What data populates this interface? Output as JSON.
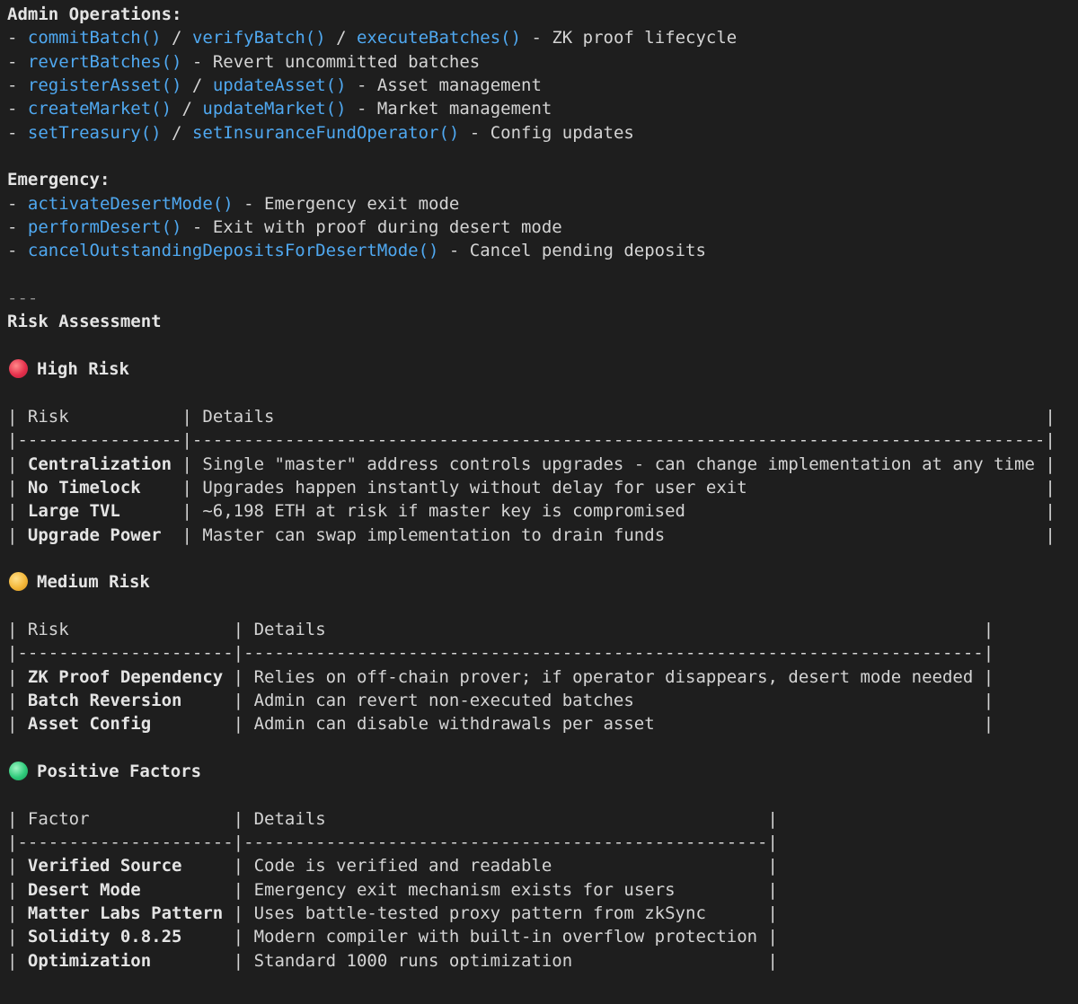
{
  "admin": {
    "heading": "Admin Operations:",
    "items": [
      {
        "fns": [
          "commitBatch()",
          "verifyBatch()",
          "executeBatches()"
        ],
        "desc": "ZK proof lifecycle"
      },
      {
        "fns": [
          "revertBatches()"
        ],
        "desc": "Revert uncommitted batches"
      },
      {
        "fns": [
          "registerAsset()",
          "updateAsset()"
        ],
        "desc": "Asset management"
      },
      {
        "fns": [
          "createMarket()",
          "updateMarket()"
        ],
        "desc": "Market management"
      },
      {
        "fns": [
          "setTreasury()",
          "setInsuranceFundOperator()"
        ],
        "desc": "Config updates"
      }
    ]
  },
  "emergency": {
    "heading": "Emergency:",
    "items": [
      {
        "fns": [
          "activateDesertMode()"
        ],
        "desc": "Emergency exit mode"
      },
      {
        "fns": [
          "performDesert()"
        ],
        "desc": "Exit with proof during desert mode"
      },
      {
        "fns": [
          "cancelOutstandingDepositsForDesertMode()"
        ],
        "desc": "Cancel pending deposits"
      }
    ]
  },
  "separator": "---",
  "risk_heading": "Risk Assessment",
  "sections": [
    {
      "icon": "red-circle-icon",
      "color": "#e5304c",
      "heading": "High Risk",
      "headers": [
        "Risk",
        "Details"
      ],
      "rows": [
        [
          "Centralization",
          "Single \"master\" address controls upgrades - can change implementation at any time"
        ],
        [
          "No Timelock",
          "Upgrades happen instantly without delay for user exit"
        ],
        [
          "Large TVL",
          "~6,198 ETH at risk if master key is compromised"
        ],
        [
          "Upgrade Power",
          "Master can swap implementation to drain funds"
        ]
      ]
    },
    {
      "icon": "yellow-circle-icon",
      "color": "#f3b73a",
      "heading": "Medium Risk",
      "headers": [
        "Risk",
        "Details"
      ],
      "rows": [
        [
          "ZK Proof Dependency",
          "Relies on off-chain prover; if operator disappears, desert mode needed"
        ],
        [
          "Batch Reversion",
          "Admin can revert non-executed batches"
        ],
        [
          "Asset Config",
          "Admin can disable withdrawals per asset"
        ]
      ]
    },
    {
      "icon": "green-circle-icon",
      "color": "#2fcb7b",
      "heading": "Positive Factors",
      "headers": [
        "Factor",
        "Details"
      ],
      "rows": [
        [
          "Verified Source",
          "Code is verified and readable"
        ],
        [
          "Desert Mode",
          "Emergency exit mechanism exists for users"
        ],
        [
          "Matter Labs Pattern",
          "Uses battle-tested proxy pattern from zkSync"
        ],
        [
          "Solidity 0.8.25",
          "Modern compiler with built-in overflow protection"
        ],
        [
          "Optimization",
          "Standard 1000 runs optimization"
        ]
      ]
    }
  ]
}
